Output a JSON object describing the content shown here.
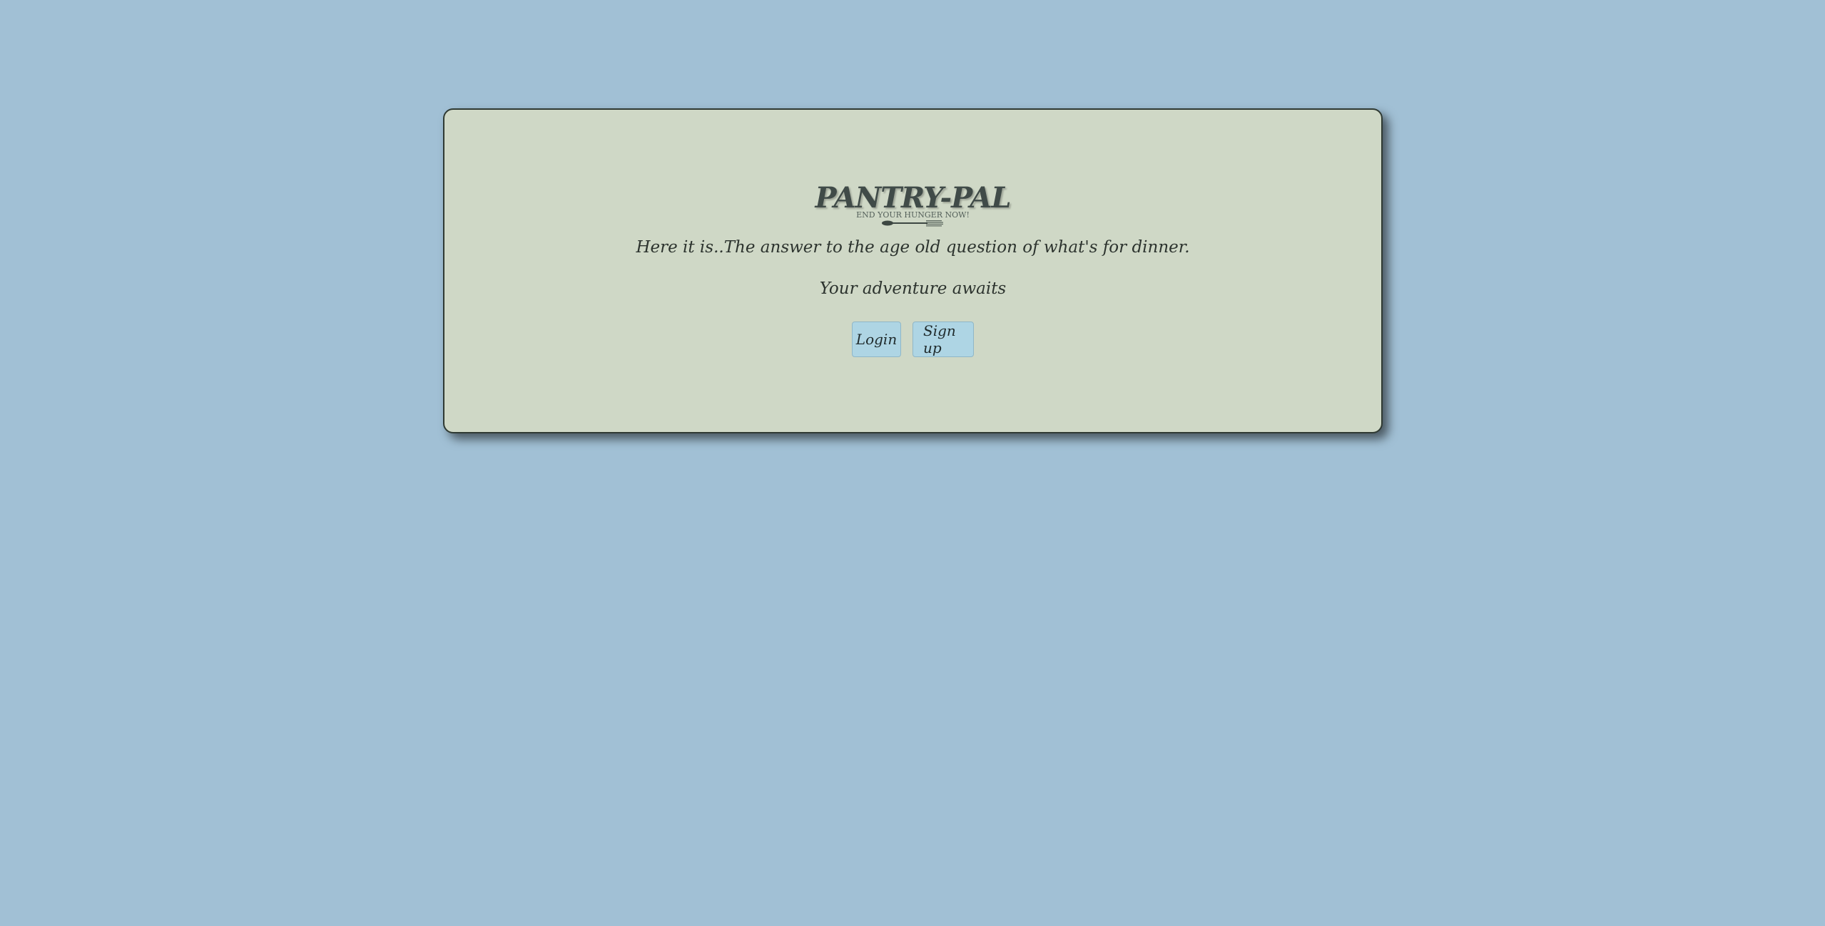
{
  "logo": {
    "title": "PANTRY-PAL",
    "tagline": "END YOUR HUNGER NOW!",
    "icon": "fork-icon"
  },
  "intro": {
    "text": "Here it is..The answer to the age old question of what's for dinner."
  },
  "adventure": {
    "text": "Your adventure awaits"
  },
  "buttons": {
    "login_label": "Login",
    "signup_label": "Sign up"
  },
  "colors": {
    "background": "#a1c0d5",
    "card": "#cfd8c6",
    "button": "#aed5e4",
    "text": "#2c332e"
  }
}
